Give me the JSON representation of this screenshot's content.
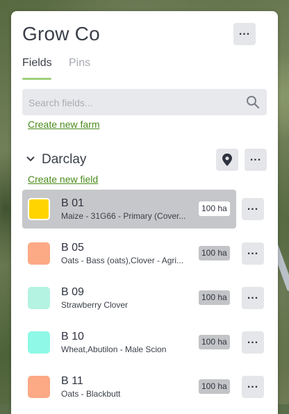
{
  "header": {
    "title": "Grow Co",
    "menu_icon": "more-icon"
  },
  "tabs": [
    {
      "label": "Fields",
      "active": true
    },
    {
      "label": "Pins",
      "active": false
    }
  ],
  "search": {
    "placeholder": "Search fields...",
    "value": "",
    "icon": "search-icon"
  },
  "links": {
    "create_farm": "Create new farm",
    "create_field": "Create new field"
  },
  "farm": {
    "name": "Darclay",
    "expanded": true
  },
  "fields": [
    {
      "name": "B 01",
      "desc": "Maize - 31G66 - Primary (Cover...",
      "area": "100 ha",
      "color": "#ffd400",
      "selected": true
    },
    {
      "name": "B 05",
      "desc": "Oats - Bass (oats),Clover - Agri...",
      "area": "100 ha",
      "color": "#fca985",
      "selected": false
    },
    {
      "name": "B 09",
      "desc": "Strawberry Clover",
      "area": "100 ha",
      "color": "#b4f3e1",
      "selected": false
    },
    {
      "name": "B 10",
      "desc": "Wheat,Abutilon - Male Scion",
      "area": "100 ha",
      "color": "#8ff8e6",
      "selected": false
    },
    {
      "name": "B 11",
      "desc": "Oats - Blackbutt",
      "area": "100 ha",
      "color": "#fca985",
      "selected": false
    }
  ],
  "colors": {
    "accent": "#4a8a1a",
    "tab_underline": "#9fd07a"
  }
}
